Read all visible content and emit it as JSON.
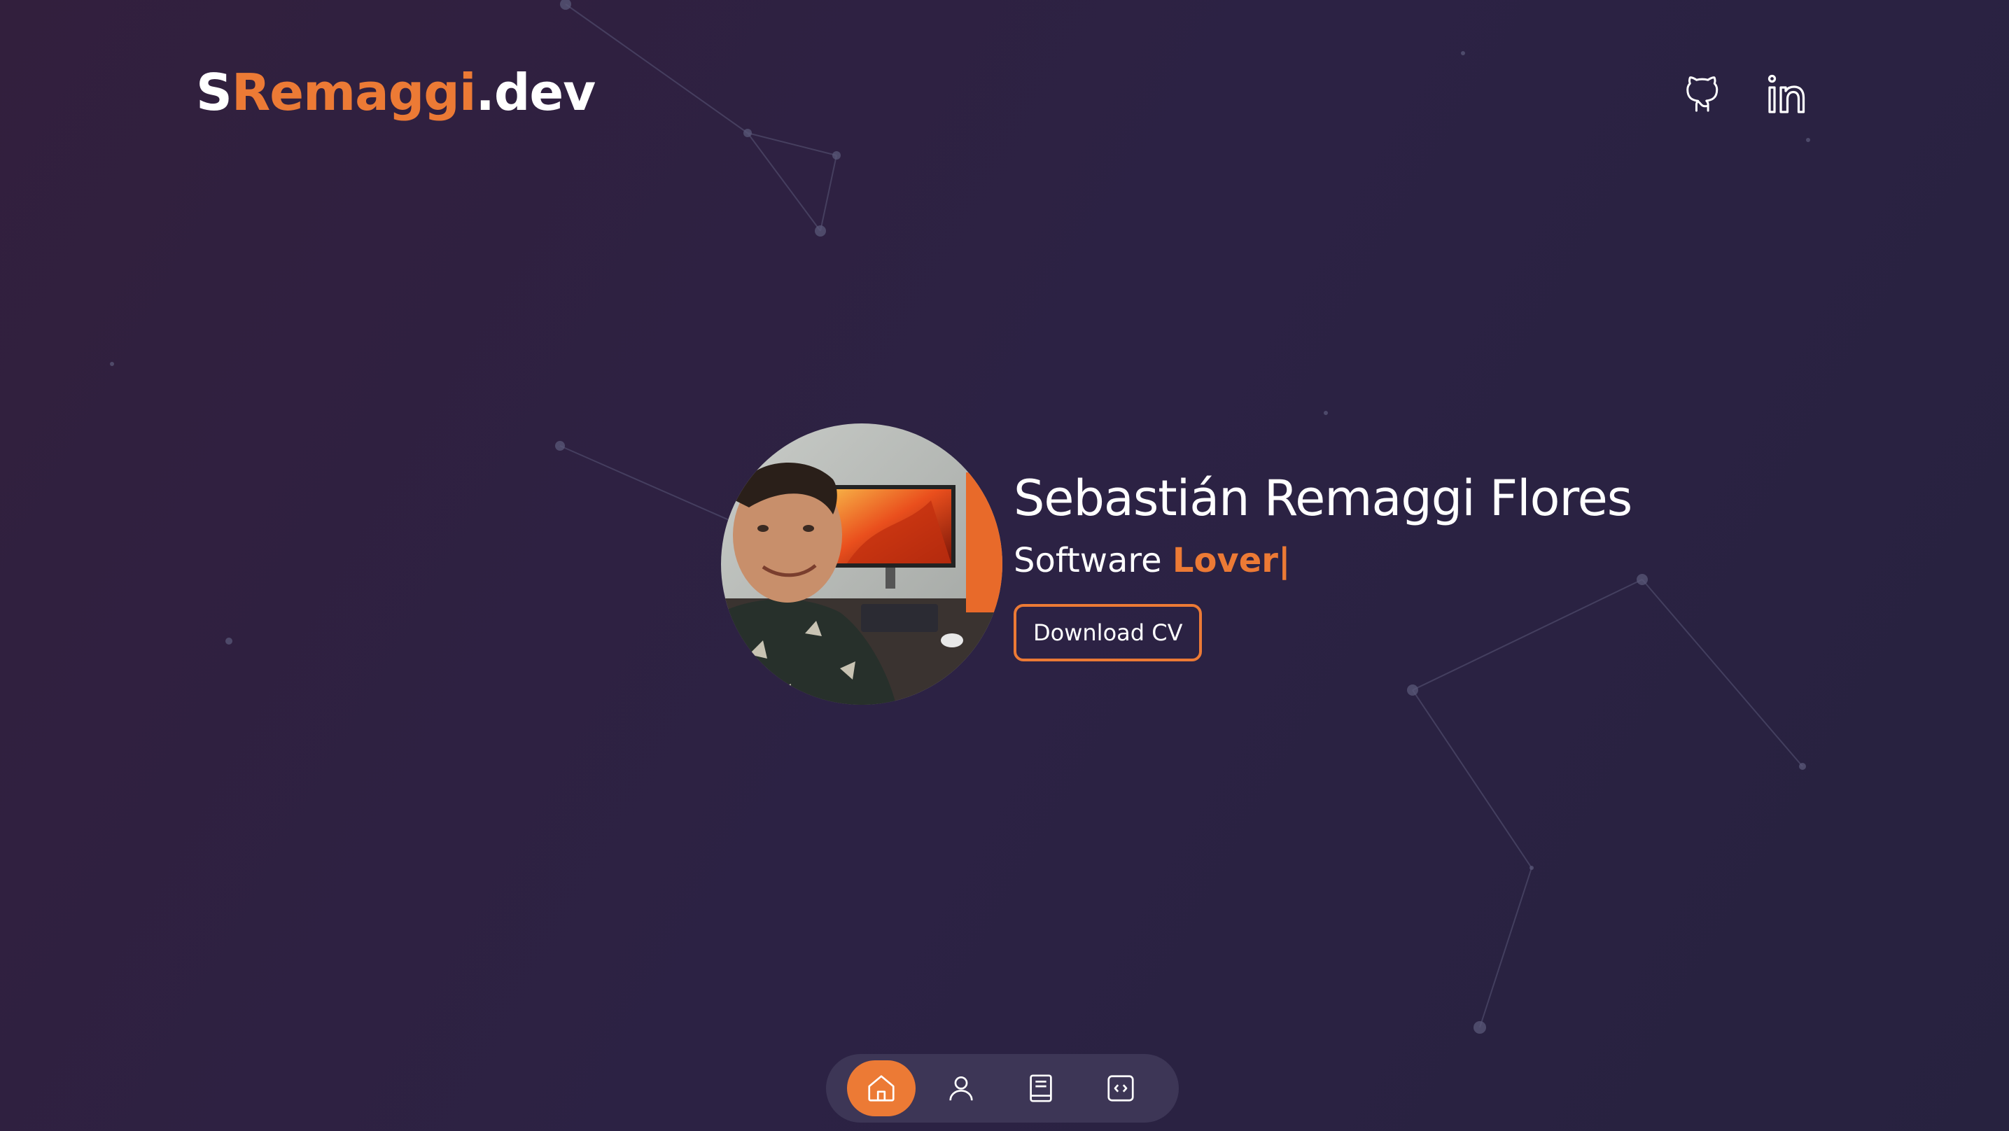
{
  "header": {
    "logo_part1": "S",
    "logo_part2": "Remaggi",
    "logo_part3": ".dev",
    "socials": [
      {
        "icon": "github-icon"
      },
      {
        "icon": "linkedin-icon"
      }
    ]
  },
  "hero": {
    "name": "Sebastián Remaggi Flores",
    "role_prefix": "Software",
    "role_highlight": "Lover|",
    "cv_button": "Download CV",
    "avatar_icon": "profile-photo"
  },
  "dock": {
    "items": [
      {
        "icon": "home-icon",
        "active": true
      },
      {
        "icon": "user-icon",
        "active": false
      },
      {
        "icon": "book-icon",
        "active": false
      },
      {
        "icon": "code-icon",
        "active": false
      }
    ]
  },
  "colors": {
    "accent": "#ec7a35",
    "background": "#2c2244",
    "dock": "#3d3656"
  }
}
